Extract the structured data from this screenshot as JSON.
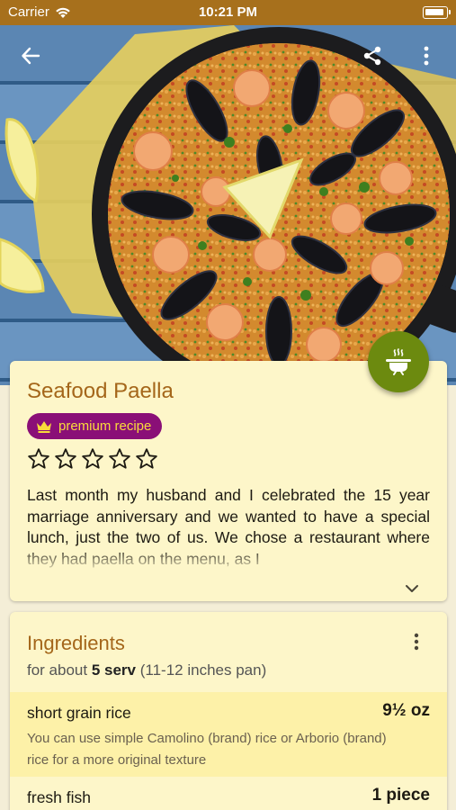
{
  "status_bar": {
    "carrier": "Carrier",
    "time": "10:21 PM"
  },
  "recipe": {
    "title": "Seafood Paella",
    "badge": "premium recipe",
    "rating": 0,
    "rating_max": 5,
    "description": "Last month my husband and I celebrated the 15 year marriage anniversary and we wanted to have a special lunch, just the two of us. We chose a restaurant where they had paella on the menu, as I"
  },
  "ingredients": {
    "title": "Ingredients",
    "servings_prefix": "for about",
    "servings_value": "5 serv",
    "servings_suffix": "(11-12 inches pan)",
    "items": [
      {
        "name": "short grain rice",
        "qty": "9½ oz",
        "note": "You can use simple Camolino (brand) rice or Arborio (brand) rice for a more original texture"
      },
      {
        "name": "fresh fish",
        "qty": "1 piece",
        "note": ""
      }
    ]
  },
  "colors": {
    "status_bar": "#a7701c",
    "accent": "#a4661a",
    "fab": "#6c8a0f",
    "badge_bg": "#8a0f77",
    "badge_text": "#f9dc3b",
    "card_bg": "#fdf6c9"
  },
  "icons": {
    "back": "arrow-left-icon",
    "share": "share-icon",
    "more": "more-vertical-icon",
    "fab": "cooking-pot-icon",
    "badge": "crown-icon",
    "expand": "chevron-down-icon"
  }
}
